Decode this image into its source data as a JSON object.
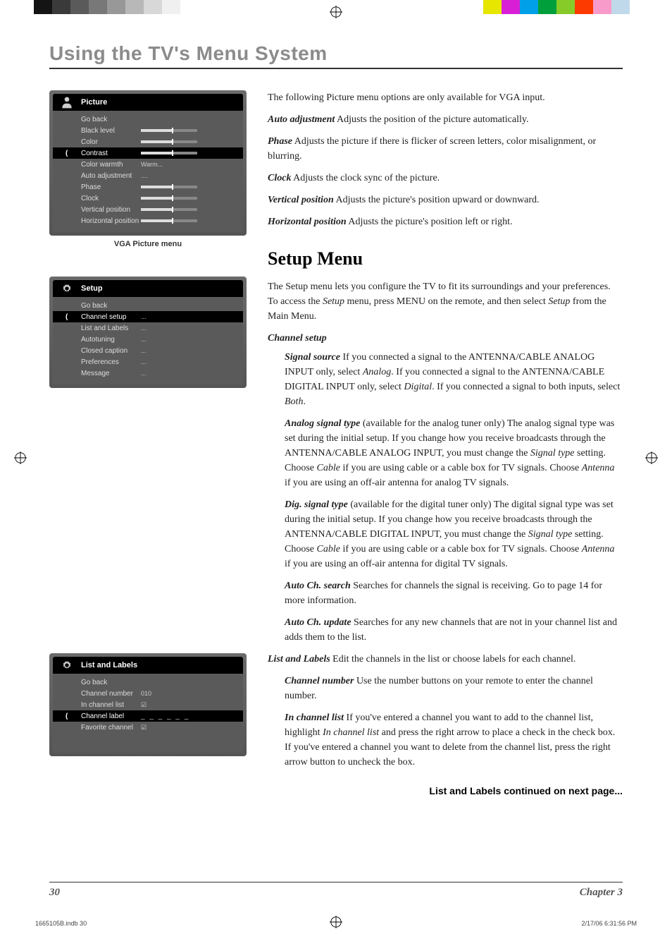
{
  "colorbar_left": [
    "#141414",
    "#3a3a3a",
    "#5a5a5a",
    "#787878",
    "#989898",
    "#b8b8b8",
    "#d8d8d8",
    "#f0f0f0"
  ],
  "colorbar_right": [
    "#e6e600",
    "#d81fd6",
    "#00a0e9",
    "#009f3b",
    "#87cb29",
    "#fd3a00",
    "#f99bca",
    "#c0d9ea"
  ],
  "page_title": "Using the TV's Menu System",
  "picture_menu": {
    "header": "Picture",
    "rows": [
      {
        "label": "Go back",
        "type": "text",
        "value": ""
      },
      {
        "label": "Black level",
        "type": "slider"
      },
      {
        "label": "Color",
        "type": "slider"
      },
      {
        "label": "Contrast",
        "type": "slider",
        "selected": true
      },
      {
        "label": "Color warmth",
        "type": "text",
        "value": "Warm..."
      },
      {
        "label": "Auto adjustment",
        "type": "text",
        "value": "...."
      },
      {
        "label": "Phase",
        "type": "slider"
      },
      {
        "label": "Clock",
        "type": "slider"
      },
      {
        "label": "Vertical position",
        "type": "slider"
      },
      {
        "label": "Horizontal position",
        "type": "slider"
      }
    ],
    "caption": "VGA Picture menu"
  },
  "setup_menu": {
    "header": "Setup",
    "rows": [
      {
        "label": "Go back",
        "type": "text",
        "value": ""
      },
      {
        "label": "Channel setup",
        "type": "text",
        "value": "...",
        "selected": true
      },
      {
        "label": "List and Labels",
        "type": "text",
        "value": "..."
      },
      {
        "label": "Autotuning",
        "type": "text",
        "value": "..."
      },
      {
        "label": "Closed caption",
        "type": "text",
        "value": "..."
      },
      {
        "label": "Preferences",
        "type": "text",
        "value": "..."
      },
      {
        "label": "Message",
        "type": "text",
        "value": "..."
      }
    ]
  },
  "list_labels_menu": {
    "header": "List and Labels",
    "rows": [
      {
        "label": "Go back",
        "type": "text",
        "value": ""
      },
      {
        "label": "Channel number",
        "type": "text",
        "value": "010"
      },
      {
        "label": "In channel list",
        "type": "check",
        "value": "☑"
      },
      {
        "label": "Channel label",
        "type": "dash",
        "value": "_ _ _ _ _ _",
        "selected": true
      },
      {
        "label": "Favorite channel",
        "type": "check",
        "value": "☑"
      }
    ]
  },
  "body": {
    "intro": "The following Picture menu options are only available for VGA input.",
    "defs": [
      {
        "term": "Auto adjustment",
        "text": "   Adjusts the position of the picture automatically."
      },
      {
        "term": "Phase",
        "text": "   Adjusts the picture if there is flicker of screen letters, color misalignment, or blurring."
      },
      {
        "term": "Clock",
        "text": "   Adjusts the clock sync of the picture."
      },
      {
        "term": "Vertical position",
        "text": "   Adjusts the picture's position upward or downward."
      },
      {
        "term": "Horizontal position",
        "text": "   Adjusts the picture's position left or right."
      }
    ],
    "setup_heading": "Setup Menu",
    "setup_intro_1": "The Setup menu lets you configure the TV to fit its surroundings and your preferences. To access the ",
    "setup_intro_2": " menu, press MENU on the remote, and then select ",
    "setup_intro_3": " from the Main Menu.",
    "setup_term": "Setup",
    "channel_setup_heading": "Channel setup",
    "signal_source": {
      "term": "Signal source",
      "t1": "   If you connected a signal to the ANTENNA/CABLE ANALOG INPUT only, select ",
      "i1": "Analog",
      "t2": ". If you connected a signal to the ANTENNA/CABLE DIGITAL INPUT only, select ",
      "i2": "Digital",
      "t3": ". If you connected a signal to both inputs, select ",
      "i3": "Both",
      "t4": "."
    },
    "analog_signal": {
      "term": "Analog signal type",
      "paren": " (available for the analog tuner only)",
      "t1": "   The analog signal type was set during the initial setup. If you change how you receive broadcasts through the ANTENNA/CABLE ANALOG INPUT, you must change the ",
      "i1": "Signal type",
      "t2": " setting. Choose ",
      "i2": "Cable",
      "t3": " if you are using cable or a cable box for TV signals. Choose ",
      "i3": "Antenna",
      "t4": " if you are using an off-air antenna for analog TV signals."
    },
    "dig_signal": {
      "term": "Dig. signal type",
      "paren": " (available for the digital tuner only)",
      "t1": "   The digital signal type was set during the initial setup. If you change how you receive broadcasts through the ANTENNA/CABLE DIGITAL INPUT, you must change the ",
      "i1": "Signal type",
      "t2": " setting. Choose ",
      "i2": "Cable",
      "t3": " if you are using cable or a cable box for TV signals. Choose ",
      "i3": "Antenna",
      "t4": " if you are using an off-air antenna for digital TV signals."
    },
    "auto_ch_search": {
      "term": "Auto Ch. search",
      "text": "   Searches for channels the signal is receiving. Go to page 14 for more information."
    },
    "auto_ch_update": {
      "term": "Auto Ch. update",
      "text": "   Searches for any new channels that are not in your channel list and adds them to the list."
    },
    "list_labels": {
      "term": "List and Labels",
      "text": "   Edit the channels in the list or choose labels for each channel."
    },
    "channel_number": {
      "term": "Channel number",
      "text": "   Use the number buttons on your remote to enter the channel number."
    },
    "in_channel_list": {
      "term": "In channel list",
      "t1": "   If you've entered a channel you want to add to the channel list, highlight ",
      "i1": "In channel list",
      "t2": " and press the right arrow to place a check in the check box. If you've entered a channel you want to delete from the channel list, press the right arrow button to uncheck the box."
    },
    "continued": "List and Labels continued on next page..."
  },
  "footer": {
    "page_num": "30",
    "chapter": "Chapter 3"
  },
  "print_footer": {
    "file": "1665105B.indb   30",
    "date": "2/17/06   6:31:56 PM"
  }
}
